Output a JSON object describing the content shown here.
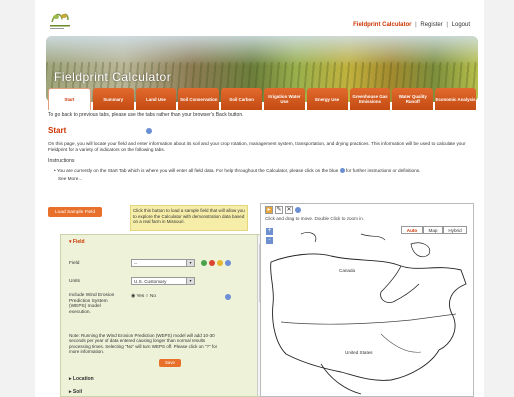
{
  "header": {
    "logo_icon": "fieldprint-logo-icon",
    "calculator_link": "Fieldprint Calculator",
    "register_link": "Register",
    "logout_link": "Logout",
    "separator": "|"
  },
  "banner": {
    "title": "Fieldprint Calculator"
  },
  "tabs": [
    {
      "label": "Start",
      "active": true
    },
    {
      "label": "Summary"
    },
    {
      "label": "Land Use"
    },
    {
      "label": "Soil Conservation"
    },
    {
      "label": "Soil Carbon"
    },
    {
      "label": "Irrigation Water Use"
    },
    {
      "label": "Energy Use"
    },
    {
      "label": "Greenhouse Gas Emissions"
    },
    {
      "label": "Water Quality Runoff"
    },
    {
      "label": "Economic Analysis"
    }
  ],
  "main": {
    "back_note": "To go back to previous tabs, please use the tabs rather than your browser's Back button.",
    "heading": "Start",
    "intro": "On this page, you will locate your field and enter information about its soil and your crop rotation, management system, transportation, and drying practices. This information will be used to calculate your Fieldprint for a variety of indicators on the following tabs.",
    "instructions_heading": "Instructions",
    "bullet_text_1": "You are currently on the Start Tab which is where you will enter all field data. For help throughout the Calculator, please click on the blue",
    "bullet_text_2": "for further instructions or definitions.",
    "see_more": "See More..."
  },
  "sample": {
    "button_label": "Load Sample Field",
    "note": "Click this button to load a sample field that will allow you to explore the Calculator with demonstration data based on a real farm in Missouri."
  },
  "field_panel": {
    "section_title": "Field",
    "field_label": "Field",
    "field_value": "--",
    "units_label": "Units",
    "units_value": "U.S. Customary",
    "weps_label": "Include Wind Erosion Prediction System (WEPS) model execution.",
    "yes_label": "Yes",
    "no_label": "No",
    "yes_checked": true,
    "note": "Note: Running the Wind Erosion Prediction (WEPS) model will add 10-30 seconds per year of data entered causing longer than normal results processing times. Selecting \"No\" will turn WEPS off. Please click on \"?\" for more information.",
    "save_label": "Save",
    "location_label": "Location",
    "soil_label": "Soil"
  },
  "map": {
    "hint": "Click and drag to move. Double Click to zoom in.",
    "zoom_in": "+",
    "zoom_out": "-",
    "types": [
      "Auto",
      "Map",
      "Hybrid"
    ],
    "active_type": "Auto",
    "label_canada": "Canada",
    "label_us": "United States"
  },
  "colors": {
    "accent": "#cc3300",
    "tab_orange": "#d9581e",
    "panel_bg": "#eef2d8",
    "note_bg": "#f6eda8"
  }
}
